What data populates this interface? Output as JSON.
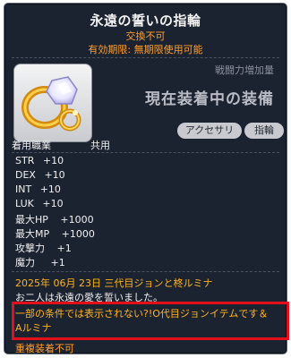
{
  "item": {
    "name": "永遠の誓いの指輪",
    "trade_status": "交換不可",
    "expiry": "有効期限: 無期限使用可能",
    "icon": "wedding-ring-icon",
    "attack_increase_label": "戦闘力増加量",
    "equipped_label": "現在装着中の装備",
    "tags": [
      "アクセサリ",
      "指輪"
    ],
    "job_label": "着用職業",
    "job_value": "共用",
    "stats": [
      {
        "name": "STR",
        "value": "+10"
      },
      {
        "name": "DEX",
        "value": "+10"
      },
      {
        "name": "INT",
        "value": "+10"
      },
      {
        "name": "LUK",
        "value": "+10"
      },
      {
        "name": "最大HP",
        "value": "+1000"
      },
      {
        "name": "最大MP",
        "value": "+1000"
      },
      {
        "name": "攻撃力",
        "value": "+1"
      },
      {
        "name": "魔力",
        "value": "+1"
      }
    ],
    "date_line": "2025年 06月 23日 三代目ジョンと柊ルミナ",
    "message": "お二人は永遠の愛を誓いました。",
    "note_line1": "一部の条件では表示されない?!O代目ジョンイテムです＆",
    "note_line2": "Aルミナ",
    "duplicate_rule": "重複装着不可"
  },
  "colors": {
    "background": "#1c2330",
    "orange": "#ff9f2e",
    "gold": "#ffb31c",
    "highlight_border": "#e3101c"
  }
}
